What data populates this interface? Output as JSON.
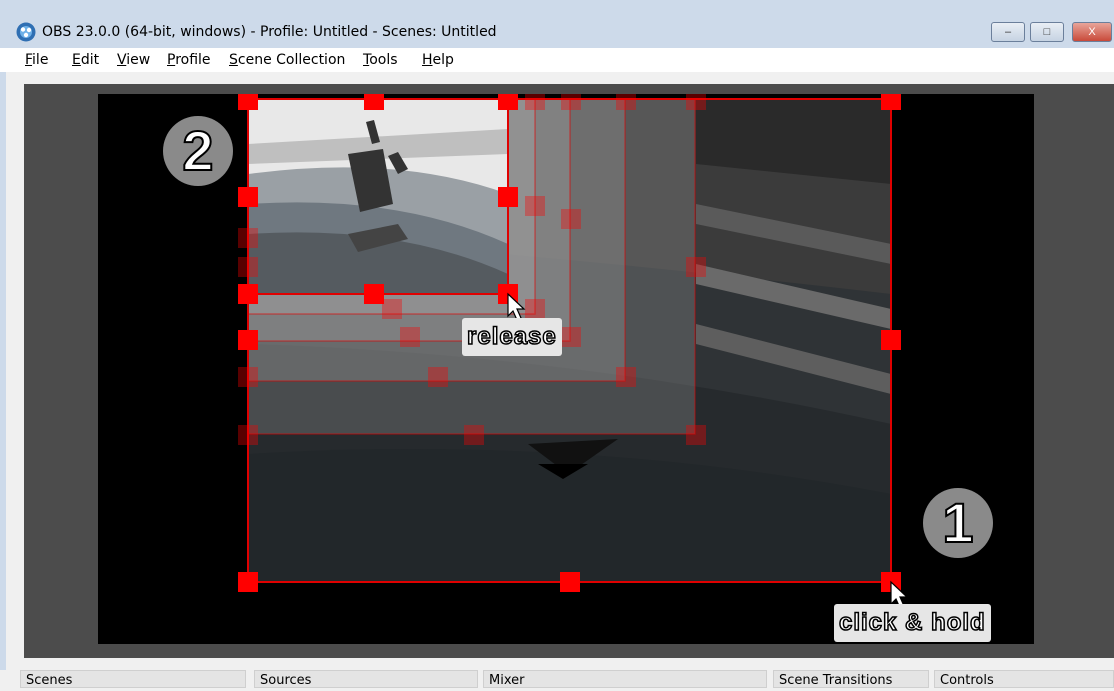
{
  "window": {
    "title": "OBS 23.0.0 (64-bit, windows) - Profile: Untitled - Scenes: Untitled",
    "minimize": "–",
    "maximize": "□",
    "close": "X"
  },
  "menu": [
    {
      "label": "File"
    },
    {
      "label": "Edit"
    },
    {
      "label": "View"
    },
    {
      "label": "Profile"
    },
    {
      "label": "Scene Collection"
    },
    {
      "label": "Tools"
    },
    {
      "label": "Help"
    }
  ],
  "annotations": {
    "step1": "1",
    "step2": "2",
    "release_label": "release",
    "click_label": "click & hold"
  },
  "docks": [
    {
      "label": "Scenes"
    },
    {
      "label": "Sources"
    },
    {
      "label": "Mixer"
    },
    {
      "label": "Scene Transitions"
    },
    {
      "label": "Controls"
    }
  ],
  "colors": {
    "handle": "#ff0000",
    "selection": "#e00000"
  }
}
